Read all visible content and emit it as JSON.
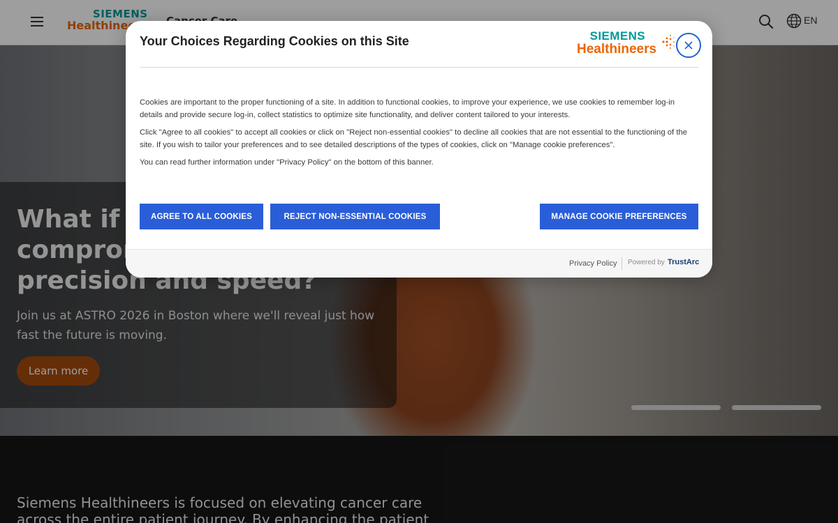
{
  "header": {
    "logo_top": "SIEMENS",
    "logo_bottom": "Healthineers",
    "product": "Cancer Care",
    "language": "EN",
    "icons": [
      "menu-icon",
      "search-icon",
      "globe-icon"
    ]
  },
  "hero": {
    "heading": "What if there were no compromise between precision and speed?",
    "subtitle": "Join us at ASTRO 2026 in Boston where we'll reveal just how fast the future is moving.",
    "cta_label": "Learn more",
    "slides": 2
  },
  "intro": {
    "text": "Siemens Healthineers is focused on elevating cancer care across the entire patient journey. By enhancing the patient experience, enabling"
  },
  "cookie_banner": {
    "title": "Your Choices Regarding Cookies on this Site",
    "logo_top": "SIEMENS",
    "logo_bottom": "Healthineers",
    "close_label": "Close",
    "paragraphs": [
      "Cookies are important to the proper functioning of a site. In addition to functional cookies, to improve your experience, we use cookies to remember log-in details and provide secure log-in, collect statistics to optimize site functionality, and deliver content tailored to your interests.",
      "Click \"Agree to all cookies\" to accept all cookies or click on \"Reject non-essential cookies\" to decline all cookies that are not essential to the functioning of the site. If you wish to tailor your preferences and to see detailed descriptions of the types of cookies, click on \"Manage cookie preferences\".",
      "You can read further information under \"Privacy Policy\" on the bottom of this banner."
    ],
    "buttons": {
      "agree": "AGREE TO ALL COOKIES",
      "reject": "REJECT NON-ESSENTIAL COOKIES",
      "manage": "MANAGE COOKIE PREFERENCES"
    },
    "footer": {
      "privacy": "Privacy Policy",
      "powered_by": "Powered by",
      "brand": "TrustArc"
    }
  },
  "colors": {
    "brand_teal": "#009999",
    "brand_orange": "#ec6602",
    "button_blue": "#2a5ed8",
    "cta_orange": "#a54b0c"
  }
}
